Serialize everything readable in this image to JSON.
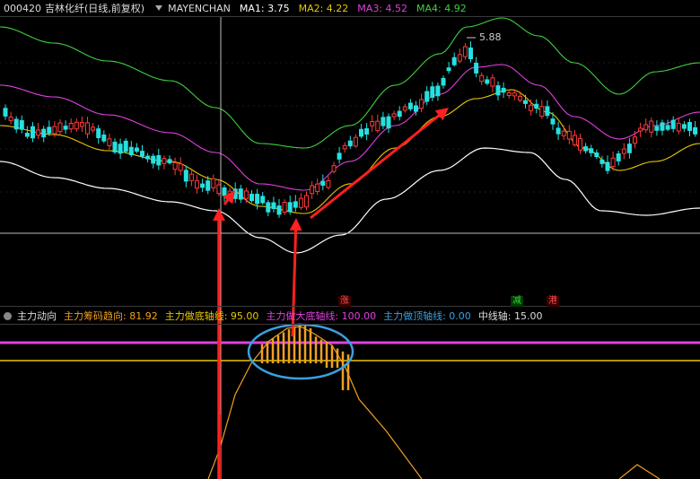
{
  "header": {
    "stock_code": "000420",
    "stock_name": "吉林化纤",
    "period_note": "(日线,前复权)",
    "indicator_name": "MAYENCHAN",
    "ma": [
      {
        "label": "MA1: 3.75",
        "color": "#ffffff"
      },
      {
        "label": "MA2: 4.22",
        "color": "#e6c800"
      },
      {
        "label": "MA3: 4.52",
        "color": "#e040e0"
      },
      {
        "label": "MA4: 4.92",
        "color": "#40d040"
      }
    ]
  },
  "subpanel": {
    "title": "主力动向",
    "items": [
      {
        "label": "主力筹码趋向: 81.92",
        "color": "#f0a020"
      },
      {
        "label": "主力做底轴线: 95.00",
        "color": "#e6c800"
      },
      {
        "label": "主力做大底轴线: 100.00",
        "color": "#e040e0"
      },
      {
        "label": "主力做顶轴线: 0.00",
        "color": "#3aa0e0"
      },
      {
        "label": "中线轴: 15.00",
        "color": "#dddddd"
      }
    ]
  },
  "price_annotation": "5.88",
  "badges": [
    {
      "text": "涨",
      "color": "#ff5050",
      "bg": "#3a0000"
    },
    {
      "text": "减",
      "color": "#40d040",
      "bg": "#003a00"
    },
    {
      "text": "港",
      "color": "#ff5050",
      "bg": "#3a0000"
    }
  ],
  "colors": {
    "up": "#ff3a3a",
    "down": "#27e0e0",
    "ma1": "#ffffff",
    "ma2": "#e6c800",
    "ma3": "#e040e0",
    "ma4": "#40d040",
    "arrow": "#ff2020",
    "ellipse": "#3aa0e0",
    "trend": "#f0a020"
  }
}
